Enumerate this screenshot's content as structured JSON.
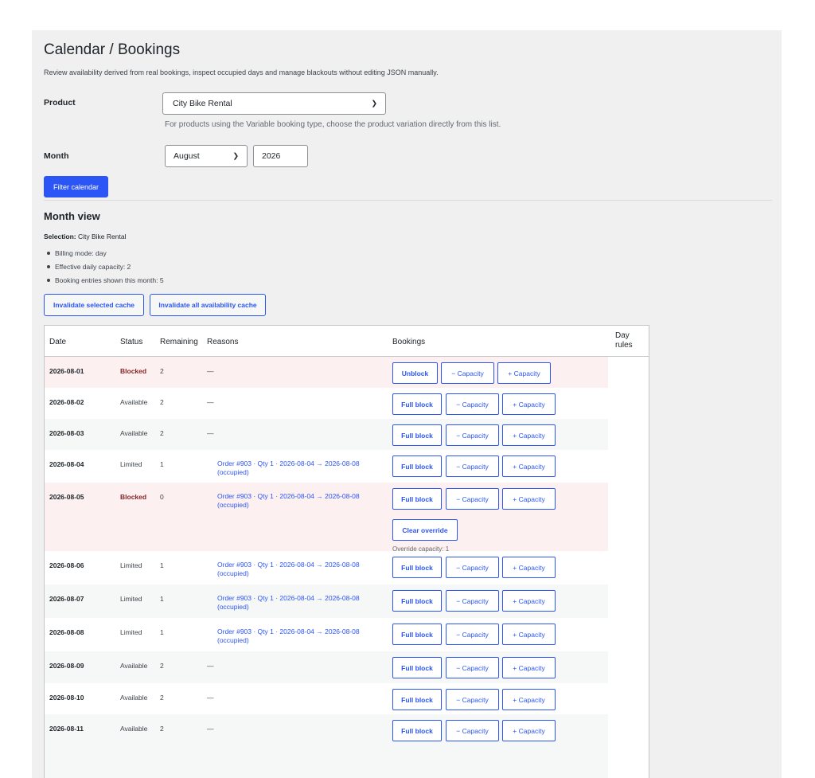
{
  "page": {
    "title": "Calendar / Bookings",
    "subtitle": "Review availability derived from real bookings, inspect occupied days and manage blackouts without editing JSON manually."
  },
  "filters": {
    "product_label": "Product",
    "product_value": "City Bike Rental",
    "product_hint": "For products using the Variable booking type, choose the product variation directly from this list.",
    "month_label": "Month",
    "month_value": "August",
    "year_value": "2026",
    "filter_button": "Filter calendar"
  },
  "month_view": {
    "heading": "Month view",
    "selection_label": "Selection:",
    "selection_value": "City Bike Rental",
    "bullets": [
      "Billing mode: day",
      "Effective daily capacity: 2",
      "Booking entries shown this month: 5"
    ],
    "invalidate_selected": "Invalidate selected cache",
    "invalidate_all": "Invalidate all availability cache"
  },
  "table": {
    "headers": {
      "date": "Date",
      "status": "Status",
      "remaining": "Remaining",
      "reasons": "Reasons",
      "bookings": "Bookings",
      "day_rules": "Day rules"
    },
    "buttons": {
      "unblock": "Unblock",
      "full_block": "Full block",
      "minus": "− Capacity",
      "plus": "+ Capacity",
      "clear_override": "Clear override"
    },
    "override_note": "Override capacity: 1",
    "rows": [
      {
        "date": "2026-08-01",
        "status": "Blocked",
        "remaining": "2",
        "reason": "—"
      },
      {
        "date": "2026-08-02",
        "status": "Available",
        "remaining": "2",
        "reason": "—"
      },
      {
        "date": "2026-08-03",
        "status": "Available",
        "remaining": "2",
        "reason": "—"
      },
      {
        "date": "2026-08-04",
        "status": "Limited",
        "remaining": "1",
        "reason": "Order #903 · Qty 1 · 2026-08-04 → 2026-08-08 (occupied)"
      },
      {
        "date": "2026-08-05",
        "status": "Blocked",
        "remaining": "0",
        "reason": "Order #903 · Qty 1 · 2026-08-04 → 2026-08-08 (occupied)"
      },
      {
        "date": "2026-08-06",
        "status": "Limited",
        "remaining": "1",
        "reason": "Order #903 · Qty 1 · 2026-08-04 → 2026-08-08 (occupied)"
      },
      {
        "date": "2026-08-07",
        "status": "Limited",
        "remaining": "1",
        "reason": "Order #903 · Qty 1 · 2026-08-04 → 2026-08-08 (occupied)"
      },
      {
        "date": "2026-08-08",
        "status": "Limited",
        "remaining": "1",
        "reason": "Order #903 · Qty 1 · 2026-08-04 → 2026-08-08 (occupied)"
      },
      {
        "date": "2026-08-09",
        "status": "Available",
        "remaining": "2",
        "reason": "—"
      },
      {
        "date": "2026-08-10",
        "status": "Available",
        "remaining": "2",
        "reason": "—"
      },
      {
        "date": "2026-08-11",
        "status": "Available",
        "remaining": "2",
        "reason": "—"
      }
    ]
  }
}
